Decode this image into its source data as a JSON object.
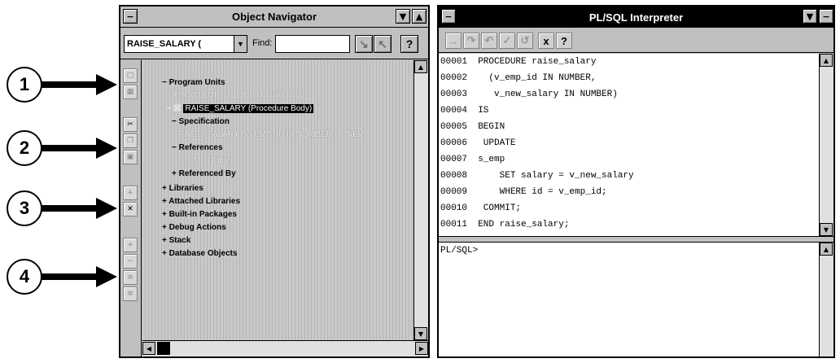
{
  "callouts": [
    "1",
    "2",
    "3",
    "4"
  ],
  "navigator": {
    "title": "Object Navigator",
    "context_value": "RAISE_SALARY (",
    "find_label": "Find:",
    "help_button": "?",
    "tree": [
      "− Program Units",
      "+ FIRST_EMP_OVER (Function Body)",
      "RAISE_SALARY (Procedure Body)",
      "− Specification",
      "RAISE_SALARY (V_EMP_ID IN NUMBER, V_NEV",
      "− References",
      "S_EMP (Table)",
      "+ Referenced By",
      "+ Libraries",
      "+ Attached Libraries",
      "+ Built-in Packages",
      "+ Debug Actions",
      "+ Stack",
      "+ Database Objects"
    ]
  },
  "interpreter": {
    "title": "PL/SQL Interpreter",
    "code_lines": [
      "00001  PROCEDURE raise_salary",
      "00002    (v_emp_id IN NUMBER,",
      "00003     v_new_salary IN NUMBER)",
      "00004  IS",
      "00005  BEGIN",
      "00006   UPDATE",
      "00007  s_emp",
      "00008      SET salary = v_new_salary",
      "00009      WHERE id = v_emp_id;",
      "00010   COMMIT;",
      "00011  END raise_salary;"
    ],
    "prompt": "PL/SQL>",
    "close_glyph": "x",
    "help_glyph": "?"
  }
}
